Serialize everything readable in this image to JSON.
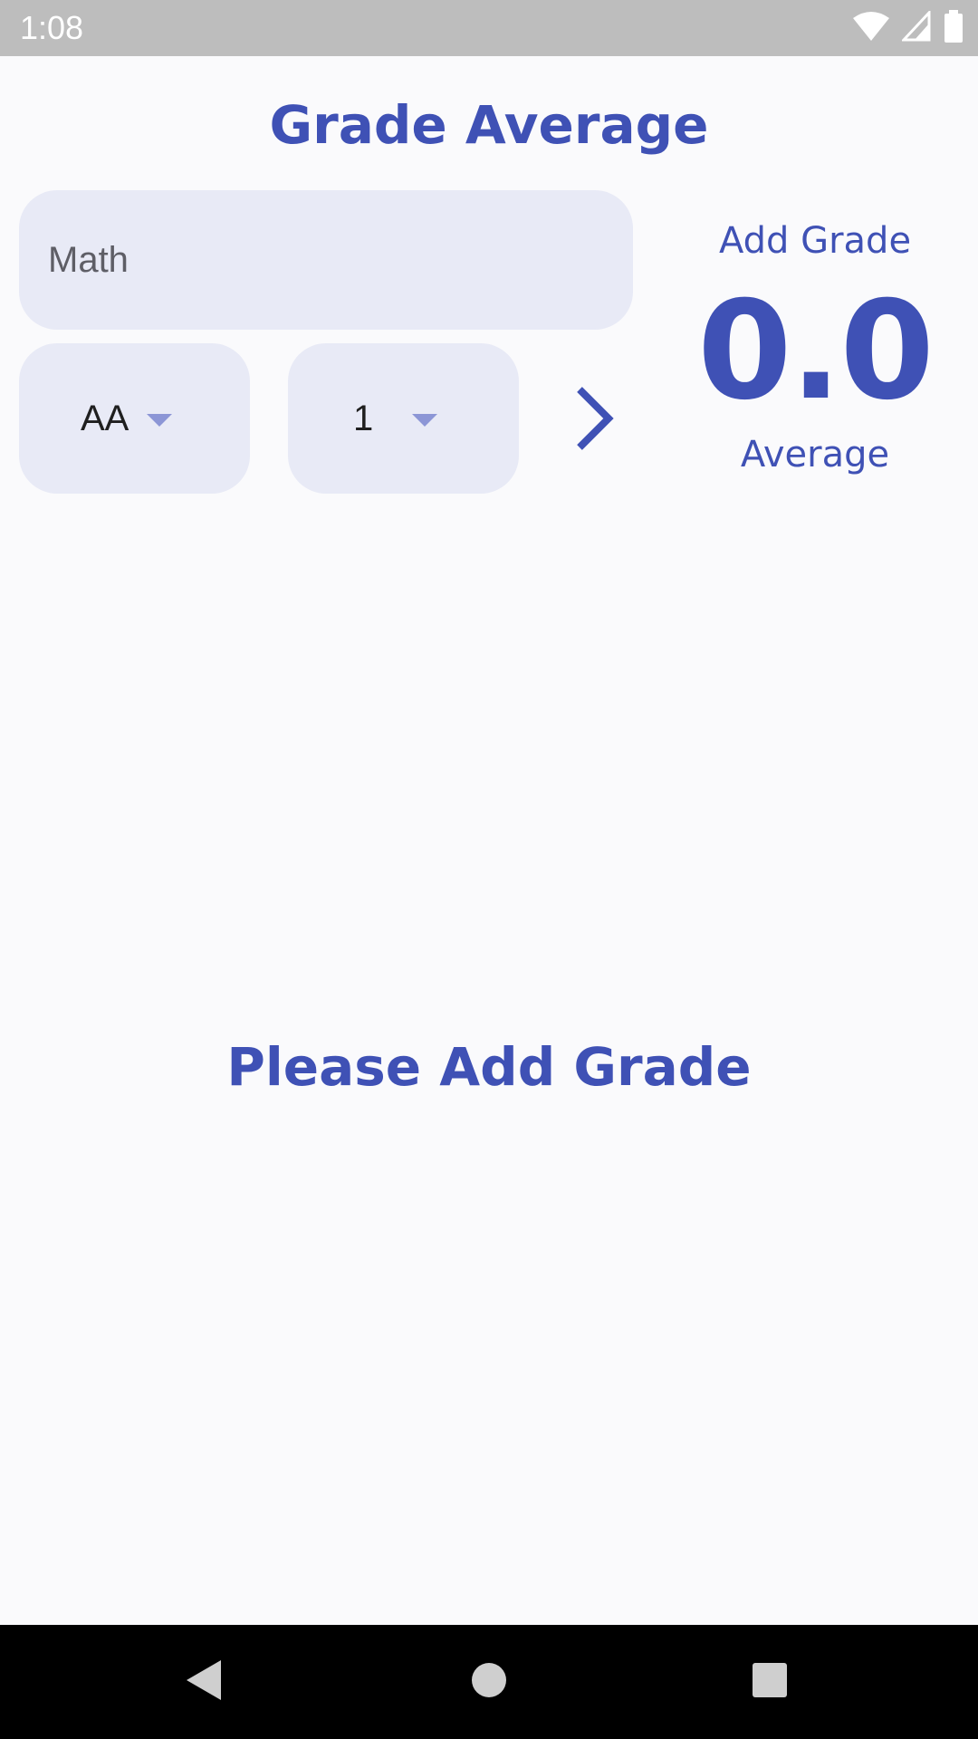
{
  "status_bar": {
    "time": "1:08",
    "icons": [
      "wifi-icon",
      "cell-signal-icon",
      "battery-icon"
    ]
  },
  "app": {
    "title": "Grade Average"
  },
  "form": {
    "course_placeholder": "Math",
    "course_value": "",
    "letter_grade": "AA",
    "credit": "1",
    "add_icon": "chevron-right-icon"
  },
  "summary": {
    "add_grade_label": "Add Grade",
    "average_value": "0.0",
    "average_label": "Average"
  },
  "list": {
    "empty_message": "Please Add Grade"
  },
  "nav_bar": {
    "icons": [
      "back-icon",
      "home-icon",
      "recents-icon"
    ]
  },
  "colors": {
    "accent": "#3F51B5",
    "field_background": "#E8EAF6",
    "caret": "#8C96D6",
    "page_background": "#FAFAFC",
    "status_bar": "#BDBDBD",
    "nav_bar": "#000000"
  }
}
